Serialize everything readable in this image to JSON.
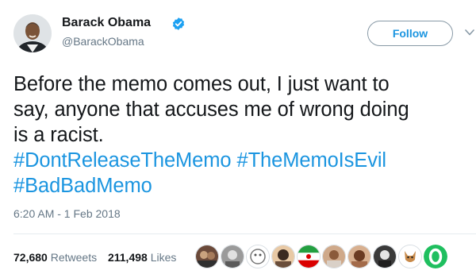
{
  "author": {
    "display_name": "Barack Obama",
    "handle": "@BarackObama",
    "verified": true,
    "avatar_icon": "user-avatar-photo"
  },
  "header": {
    "follow_label": "Follow",
    "menu_icon": "chevron-down-icon"
  },
  "tweet": {
    "line1": "Before the memo comes out, I just want to",
    "line2": "say, anyone that accuses me of wrong doing",
    "line3": "is a racist.",
    "hashtags": [
      "#DontReleaseTheMemo",
      "#TheMemoIsEvil",
      "#BadBadMemo"
    ],
    "timestamp": "6:20 AM - 1 Feb 2018"
  },
  "stats": {
    "retweets_count": "72,680",
    "retweets_label": "Retweets",
    "likes_count": "211,498",
    "likes_label": "Likes"
  },
  "colors": {
    "link": "#1b95e0",
    "text": "#14171a",
    "secondary": "#657786",
    "verified": "#1da1f2"
  }
}
